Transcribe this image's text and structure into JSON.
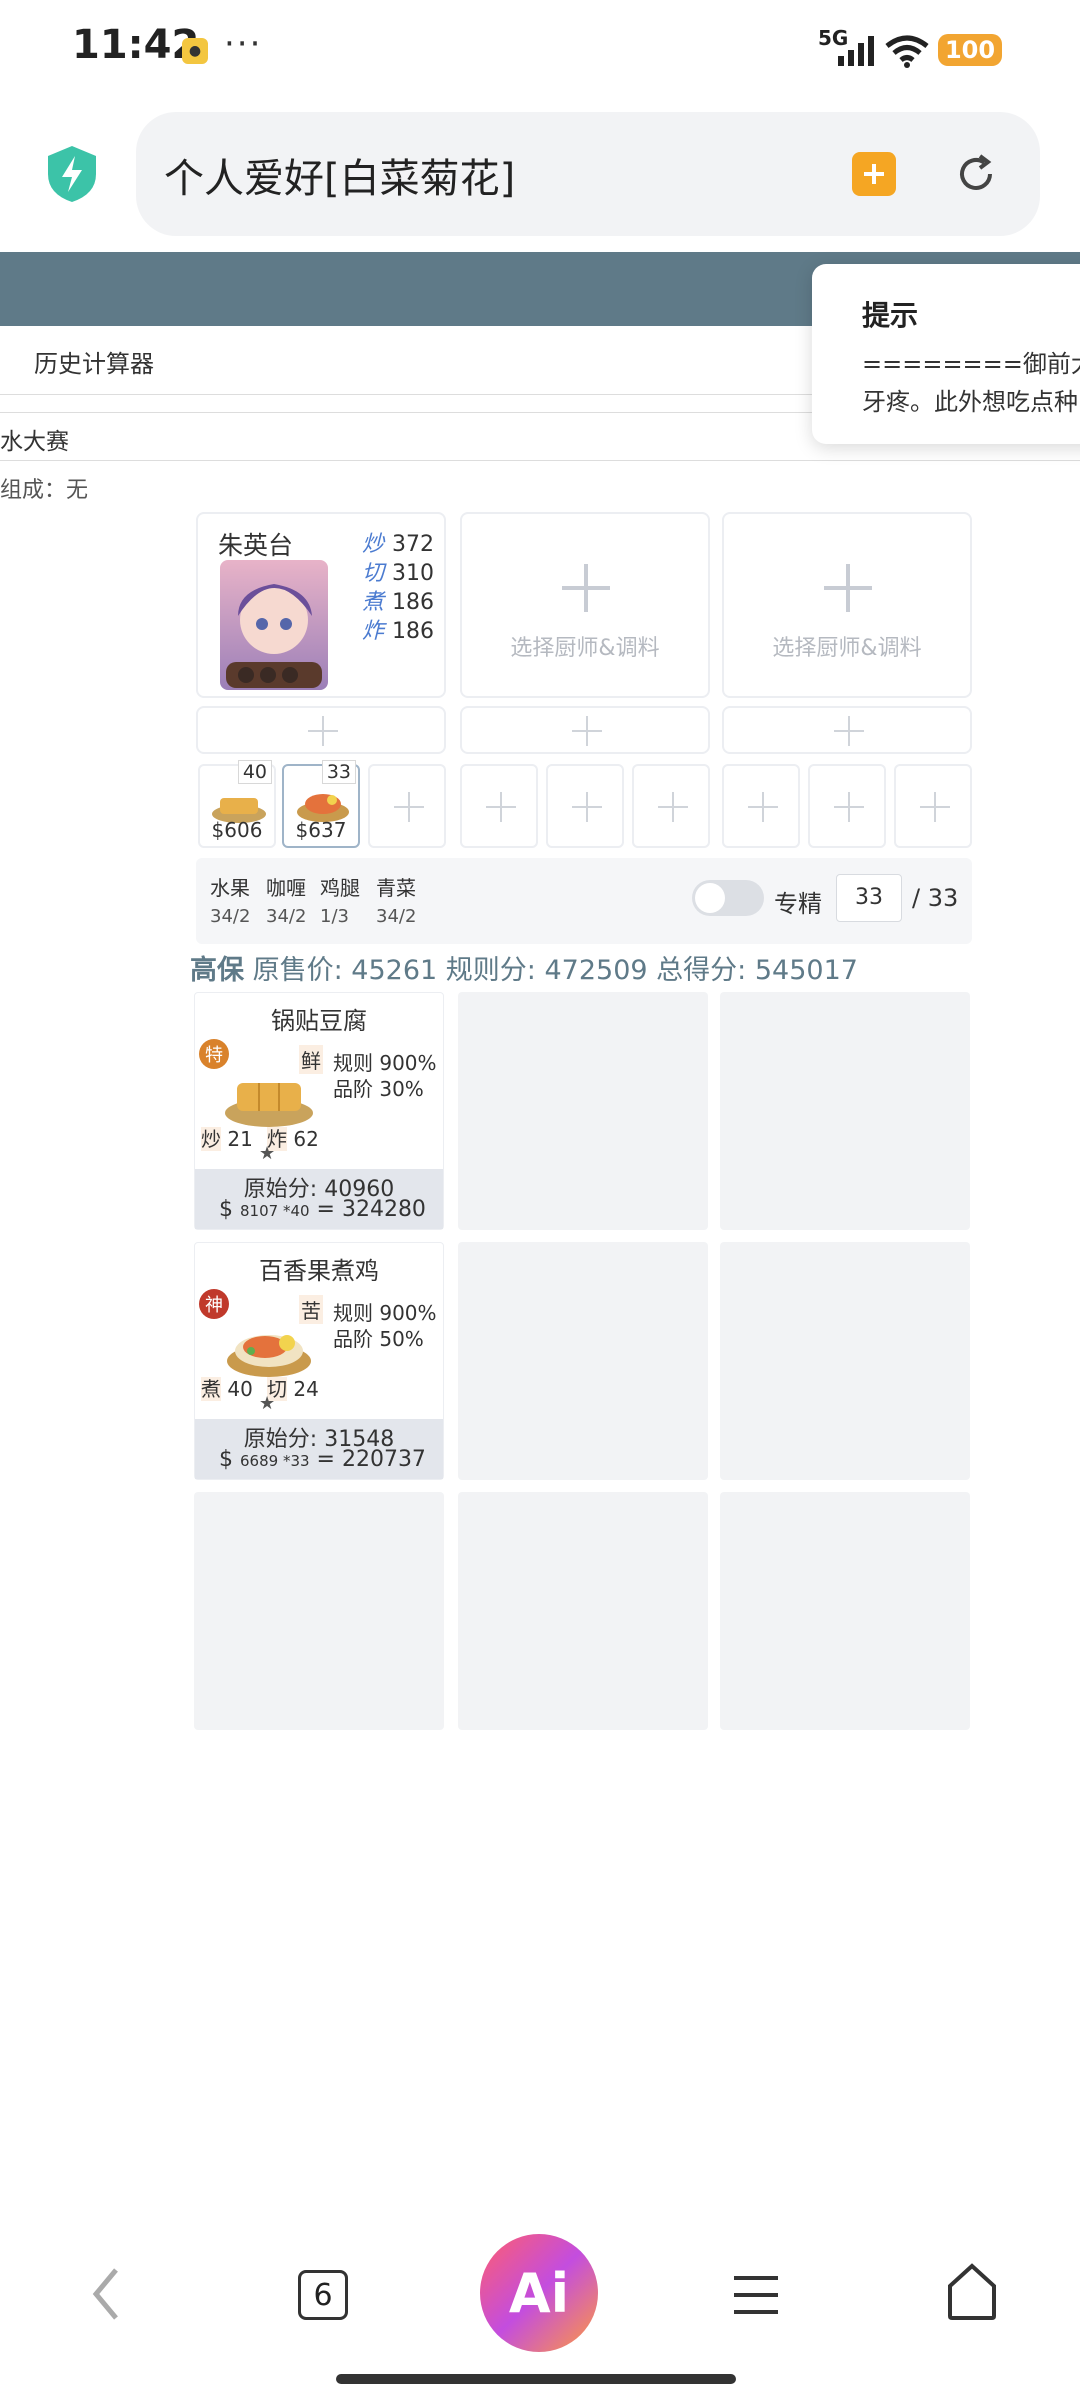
{
  "status_bar": {
    "time": "11:42",
    "dots": "···",
    "network": "5G",
    "battery": "100"
  },
  "browser": {
    "url_text": "个人爱好[白菜菊花]"
  },
  "page": {
    "history_tab": "历史计算器",
    "contest_label": "水大赛",
    "combo_label": "组成：无"
  },
  "tooltip": {
    "title": "提示",
    "line1": "========御前大赛",
    "line2": "牙疼。此外想吃点种"
  },
  "chef": {
    "name": "朱英台",
    "skills": [
      {
        "label": "炒",
        "value": "372"
      },
      {
        "label": "切",
        "value": "310"
      },
      {
        "label": "煮",
        "value": "186"
      },
      {
        "label": "炸",
        "value": "186"
      }
    ],
    "placeholder": "选择厨师&调料"
  },
  "dishes": [
    {
      "qty": "40",
      "price": "$606"
    },
    {
      "qty": "33",
      "price": "$637"
    }
  ],
  "ingredients": [
    {
      "name": "水果",
      "value": "34/2"
    },
    {
      "name": "咖喱",
      "value": "34/2"
    },
    {
      "name": "鸡腿",
      "value": "1/3"
    },
    {
      "name": "青菜",
      "value": "34/2"
    }
  ],
  "specialty": {
    "label": "专精",
    "value": "33",
    "total": "/ 33"
  },
  "score": {
    "level": "高保",
    "price_label": "原售价:",
    "price": "45261",
    "rule_label": "规则分:",
    "rule": "472509",
    "total_label": "总得分:",
    "total": "545017"
  },
  "recipes": [
    {
      "name": "锅贴豆腐",
      "rarity": "特",
      "rarity_color": "#d9822b",
      "tag": "鲜",
      "rule": "规则 900%",
      "grade": "品阶 30%",
      "skill1_label": "炒",
      "skill1_value": "21",
      "skill2_label": "炸",
      "skill2_value": "62",
      "star": "★",
      "orig": "原始分: 40960",
      "calc_prefix": "$",
      "calc_small": "8107 *40",
      "calc_result": " = 324280"
    },
    {
      "name": "百香果煮鸡",
      "rarity": "神",
      "rarity_color": "#c0392b",
      "tag": "苦",
      "rule": "规则 900%",
      "grade": "品阶 50%",
      "skill1_label": "煮",
      "skill1_value": "40",
      "skill2_label": "切",
      "skill2_value": "24",
      "star": "★",
      "orig": "原始分: 31548",
      "calc_prefix": "$",
      "calc_small": "6689 *33",
      "calc_result": " = 220737"
    }
  ],
  "nav": {
    "tabs_count": "6",
    "ai_label": "Ai"
  }
}
